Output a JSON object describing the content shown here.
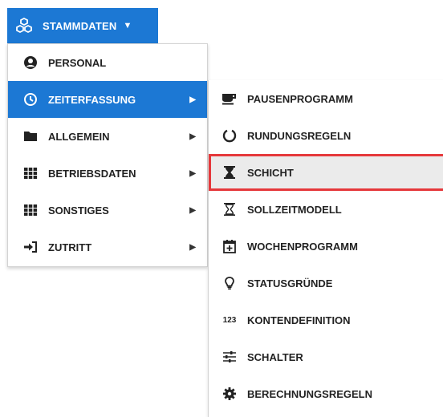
{
  "top_button": {
    "label": "STAMMDATEN",
    "icon": "cubes-icon"
  },
  "menu1": {
    "items": [
      {
        "label": "PERSONAL",
        "icon": "person-icon"
      },
      {
        "label": "ZEITERFASSUNG",
        "icon": "clock-icon",
        "active": true
      },
      {
        "label": "ALLGEMEIN",
        "icon": "folder-icon"
      },
      {
        "label": "BETRIEBSDATEN",
        "icon": "grid-icon"
      },
      {
        "label": "SONSTIGES",
        "icon": "grid-icon"
      },
      {
        "label": "ZUTRITT",
        "icon": "sign-in-icon"
      }
    ]
  },
  "menu2": {
    "items": [
      {
        "label": "PAUSENPROGRAMM",
        "icon": "coffee-icon"
      },
      {
        "label": "RUNDUNGSREGELN",
        "icon": "circle-notch-icon"
      },
      {
        "label": "SCHICHT",
        "icon": "hourglass-icon",
        "highlighted": true
      },
      {
        "label": "SOLLZEITMODELL",
        "icon": "hourglass-outline-icon"
      },
      {
        "label": "WOCHENPROGRAMM",
        "icon": "calendar-plus-icon"
      },
      {
        "label": "STATUSGRÜNDE",
        "icon": "lightbulb-icon"
      },
      {
        "label": "KONTENDEFINITION",
        "icon": "number-icon",
        "icon_text": "123"
      },
      {
        "label": "SCHALTER",
        "icon": "sliders-icon"
      },
      {
        "label": "BERECHNUNGSREGELN",
        "icon": "cog-icon"
      }
    ]
  },
  "colors": {
    "accent": "#1c78d4",
    "highlight_border": "#e5383b",
    "highlight_bg": "#ebebeb"
  }
}
